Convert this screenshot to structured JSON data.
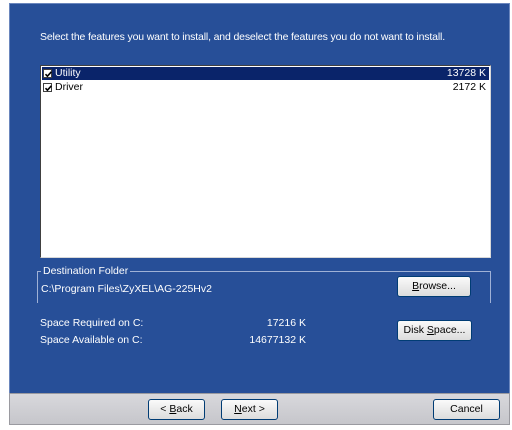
{
  "instructions": "Select the features you want to install, and deselect the features you do not want to install.",
  "features": [
    {
      "name": "Utility",
      "size": "13728 K",
      "checked": true,
      "selected": true
    },
    {
      "name": "Driver",
      "size": "2172 K",
      "checked": true,
      "selected": false
    }
  ],
  "destination": {
    "legend": "Destination Folder",
    "path": "C:\\Program Files\\ZyXEL\\AG-225Hv2",
    "browse": {
      "pre": "",
      "key": "B",
      "post": "rowse..."
    }
  },
  "space": {
    "required_label": "Space Required on C:",
    "required_value": "17216 K",
    "available_label": "Space Available on C:",
    "available_value": "14677132 K",
    "disk_space": {
      "pre": "Disk ",
      "key": "S",
      "post": "pace..."
    }
  },
  "footer": {
    "back": {
      "pre": "< ",
      "key": "B",
      "post": "ack"
    },
    "next": {
      "pre": "",
      "key": "N",
      "post": "ext >"
    },
    "cancel": "Cancel"
  }
}
